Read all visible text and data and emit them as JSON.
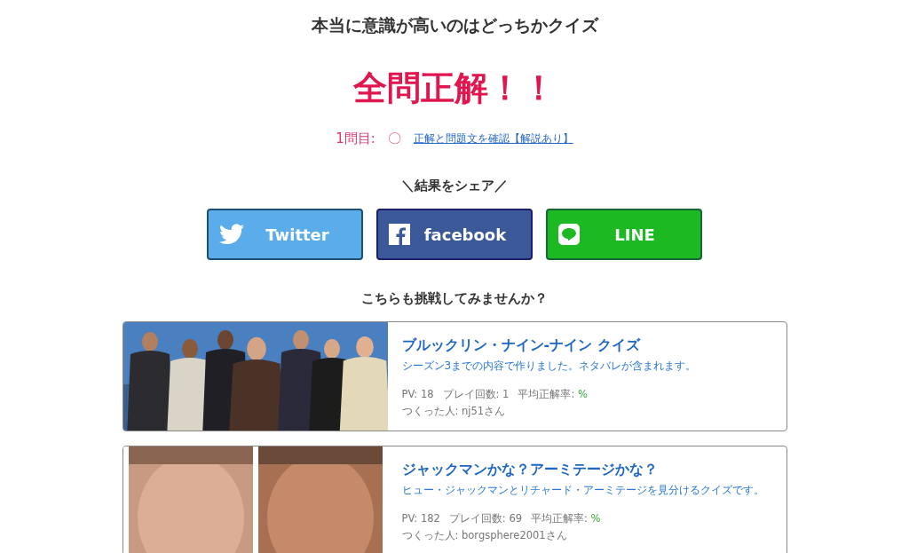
{
  "quiz_title": "本当に意識が高いのはどっちかクイズ",
  "result_heading": "全問正解！！",
  "answers": [
    {
      "label": "1問目:",
      "mark": "〇",
      "link": "正解と問題文を確認【解説あり】"
    }
  ],
  "share": {
    "label": "＼結果をシェア／",
    "buttons": [
      {
        "kind": "twitter",
        "label": "Twitter"
      },
      {
        "kind": "facebook",
        "label": "facebook"
      },
      {
        "kind": "line",
        "label": "LINE"
      }
    ]
  },
  "related": {
    "heading": "こちらも挑戦してみませんか？",
    "quizzes": [
      {
        "title": "ブルックリン・ナイン-ナイン クイズ",
        "description": "シーズン3までの内容で作りました。ネタバレが含まれます。",
        "pv_label": "PV:",
        "pv": "18",
        "plays_label": "プレイ回数:",
        "plays": "1",
        "rate_label": "平均正解率:",
        "rate": "%",
        "author": "つくった人: nj51さん"
      },
      {
        "title": "ジャックマンかな？アーミテージかな？",
        "description": "ヒュー・ジャックマンとリチャード・アーミテージを見分けるクイズです。",
        "pv_label": "PV:",
        "pv": "182",
        "plays_label": "プレイ回数:",
        "plays": "69",
        "rate_label": "平均正解率:",
        "rate": "%",
        "author": "つくった人: borgsphere2001さん"
      }
    ]
  }
}
